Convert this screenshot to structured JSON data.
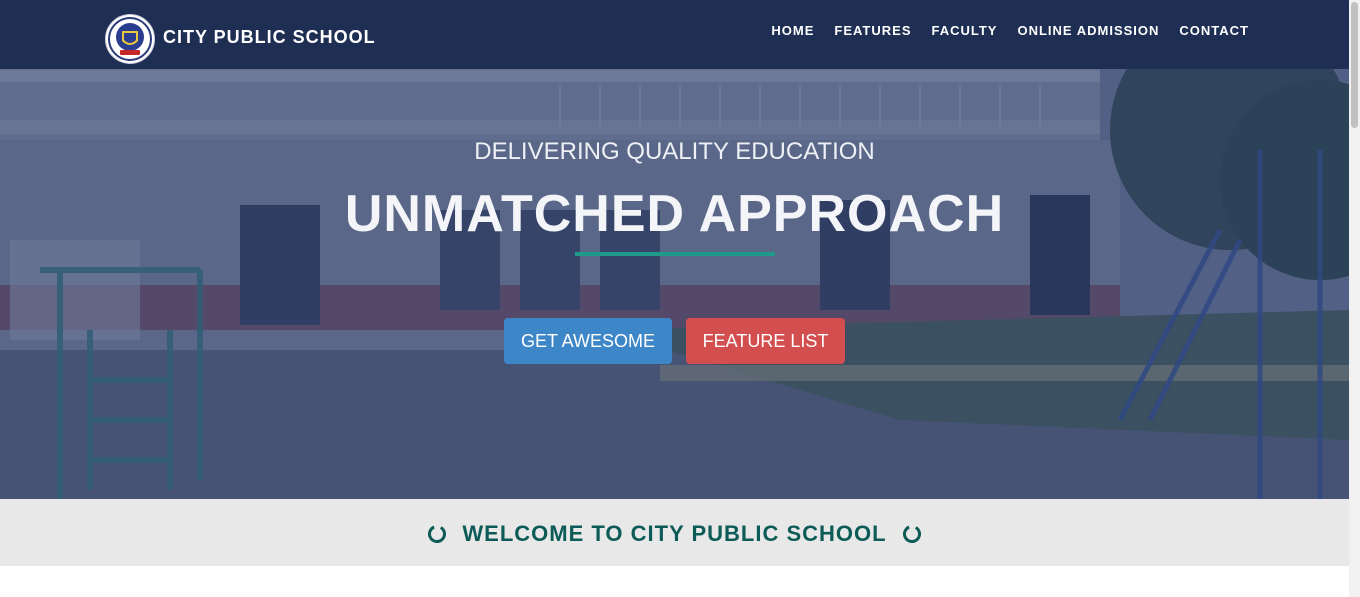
{
  "brand": {
    "name": "CITY PUBLIC SCHOOL",
    "logo_icon": "school-crest-icon"
  },
  "nav": {
    "items": [
      {
        "label": "HOME"
      },
      {
        "label": "FEATURES"
      },
      {
        "label": "FACULTY"
      },
      {
        "label": "ONLINE ADMISSION"
      },
      {
        "label": "CONTACT"
      }
    ]
  },
  "hero": {
    "subtitle": "DELIVERING QUALITY EDUCATION",
    "title": "UNMATCHED APPROACH",
    "primary_button": "GET AWESOME",
    "secondary_button": "FEATURE LIST"
  },
  "welcome": {
    "title": "WELCOME TO CITY PUBLIC SCHOOL",
    "icon": "circle-ring-icon"
  },
  "colors": {
    "navbar": "#1f2f54",
    "accent_rule": "#1f9a8a",
    "primary_button": "#3d87c9",
    "danger_button": "#d34e4e",
    "welcome_text": "#0d5b57",
    "welcome_band": "#e8e8e9"
  }
}
